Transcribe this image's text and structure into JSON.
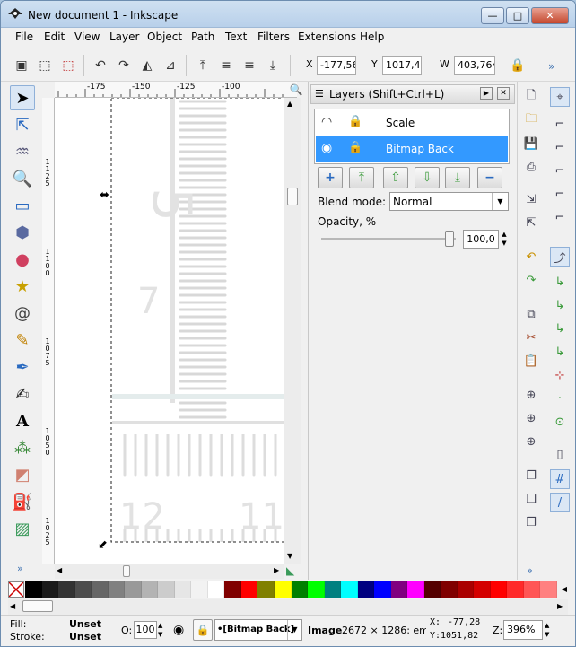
{
  "window": {
    "title": "New document 1 - Inkscape",
    "buttons": {
      "minimize": "—",
      "maximize": "□",
      "close": "✕"
    }
  },
  "menu": [
    "File",
    "Edit",
    "View",
    "Layer",
    "Object",
    "Path",
    "Text",
    "Filters",
    "Extensions",
    "Help"
  ],
  "toolbar": {
    "x_label": "X",
    "x_value": "-177,56(",
    "y_label": "Y",
    "y_value": "1017,49",
    "w_label": "W",
    "w_value": "403,764",
    "more": "»"
  },
  "ruler": {
    "h_ticks": [
      "-175",
      "-150",
      "-125",
      "-100"
    ],
    "v_ticks": [
      "1125",
      "1100",
      "1075",
      "1050",
      "1025"
    ]
  },
  "layers_panel": {
    "title": "Layers (Shift+Ctrl+L)",
    "layers": [
      {
        "name": "Scale",
        "visible": false,
        "locked": true,
        "selected": false
      },
      {
        "name": "Bitmap Back",
        "visible": true,
        "locked": true,
        "selected": true
      }
    ],
    "blend_mode_label": "Blend mode:",
    "blend_mode_value": "Normal",
    "opacity_label": "Opacity, %",
    "opacity_value": "100,0",
    "opacity_level": 1.0
  },
  "palette": {
    "colors": [
      "#000000",
      "#1a1a1a",
      "#333333",
      "#4d4d4d",
      "#666666",
      "#808080",
      "#999999",
      "#b3b3b3",
      "#cccccc",
      "#e6e6e6",
      "#f2f2f2",
      "#ffffff",
      "#800000",
      "#ff0000",
      "#808000",
      "#ffff00",
      "#008000",
      "#00ff00",
      "#008080",
      "#00ffff",
      "#000080",
      "#0000ff",
      "#800080",
      "#ff00ff",
      "#550000",
      "#800000",
      "#aa0000",
      "#d40000",
      "#ff0000",
      "#ff2a2a",
      "#ff5555",
      "#ff8080"
    ]
  },
  "status": {
    "fill_label": "Fill:",
    "fill_value": "Unset",
    "stroke_label": "Stroke:",
    "stroke_value": "Unset",
    "opacity_label": "O:",
    "opacity_value": "100",
    "layer_select": "•[Bitmap Back]",
    "message_bold": "Image",
    "message": "2672 × 1286: emb",
    "cursor_x_label": "X:",
    "cursor_x": "-77,28",
    "cursor_y_label": "Y:",
    "cursor_y": "1051,82",
    "zoom_label": "Z:",
    "zoom_value": "396%"
  }
}
